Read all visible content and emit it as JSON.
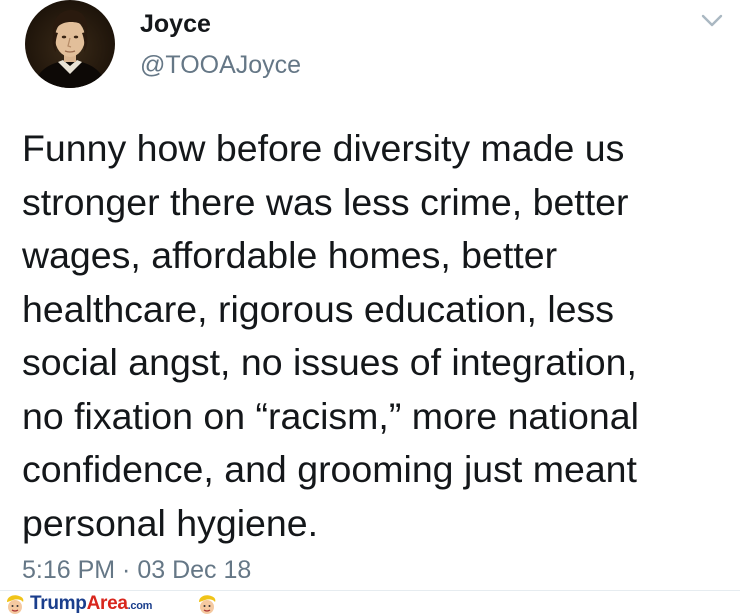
{
  "tweet": {
    "author_name": "Joyce",
    "author_handle": "@TOOAJoyce",
    "text": "Funny how before diversity made us\nstronger there was less crime, better\nwages, affordable homes, better\nhealthcare, rigorous education, less\nsocial angst, no issues of integration,\nno fixation on “racism,” more national\nconfidence, and grooming just meant\npersonal hygiene.",
    "timestamp": "5:16 PM · 03 Dec 18"
  },
  "icons": {
    "menu": "chevron-down-icon",
    "avatar": "portrait-avatar",
    "footer_left": "trump-face-icon",
    "footer_right": "trump-face-icon"
  },
  "watermark": {
    "brand_part1": "Trump",
    "brand_part2": "Area",
    "brand_suffix": ".com"
  },
  "colors": {
    "text": "#14171a",
    "secondary": "#657786",
    "brand_blue": "#1a3e8c",
    "brand_red": "#d8261d"
  }
}
